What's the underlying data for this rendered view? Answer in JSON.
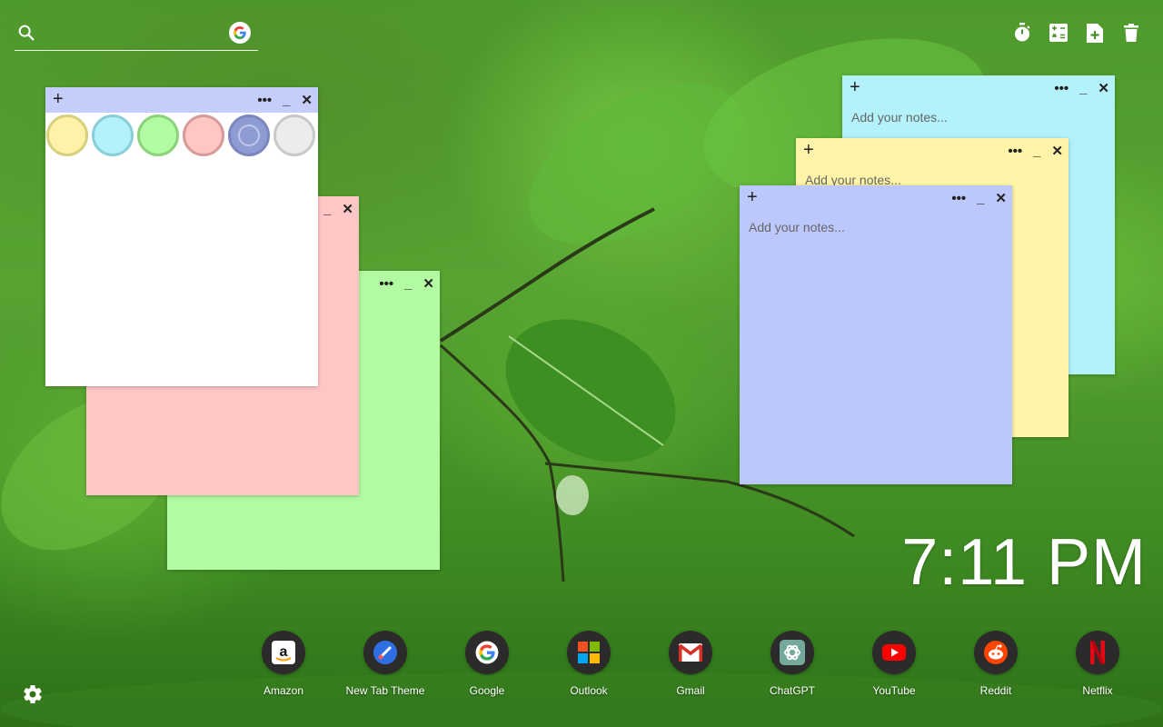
{
  "search": {
    "placeholder": ""
  },
  "tools": [
    {
      "icon": "stopwatch-icon"
    },
    {
      "icon": "calculator-icon"
    },
    {
      "icon": "add-note-icon"
    },
    {
      "icon": "trash-icon"
    }
  ],
  "notes": {
    "white": {
      "color": "#ffffff",
      "bar": "#c5cdfa"
    },
    "pink": {
      "color": "#ffc6c6"
    },
    "green": {
      "color": "#b3fba2"
    },
    "cyan": {
      "color": "#b3f1fb",
      "placeholder": "Add your notes..."
    },
    "yellow": {
      "color": "#fff4a8",
      "placeholder": "Add your notes..."
    },
    "blue": {
      "color": "#bcc7fb",
      "placeholder": "Add your notes..."
    }
  },
  "swatches": [
    "#fff2a8",
    "#b3f1fb",
    "#b3fba2",
    "#ffc6c6",
    "#8f9bd3",
    "#ececec"
  ],
  "note_controls": {
    "plus": "+",
    "more": "•••",
    "minimize": "_",
    "close": "✕"
  },
  "clock": "7:11 PM",
  "shortcuts": [
    {
      "label": "Amazon"
    },
    {
      "label": "New Tab Theme"
    },
    {
      "label": "Google"
    },
    {
      "label": "Outlook"
    },
    {
      "label": "Gmail"
    },
    {
      "label": "ChatGPT"
    },
    {
      "label": "YouTube"
    },
    {
      "label": "Reddit"
    },
    {
      "label": "Netflix"
    }
  ]
}
